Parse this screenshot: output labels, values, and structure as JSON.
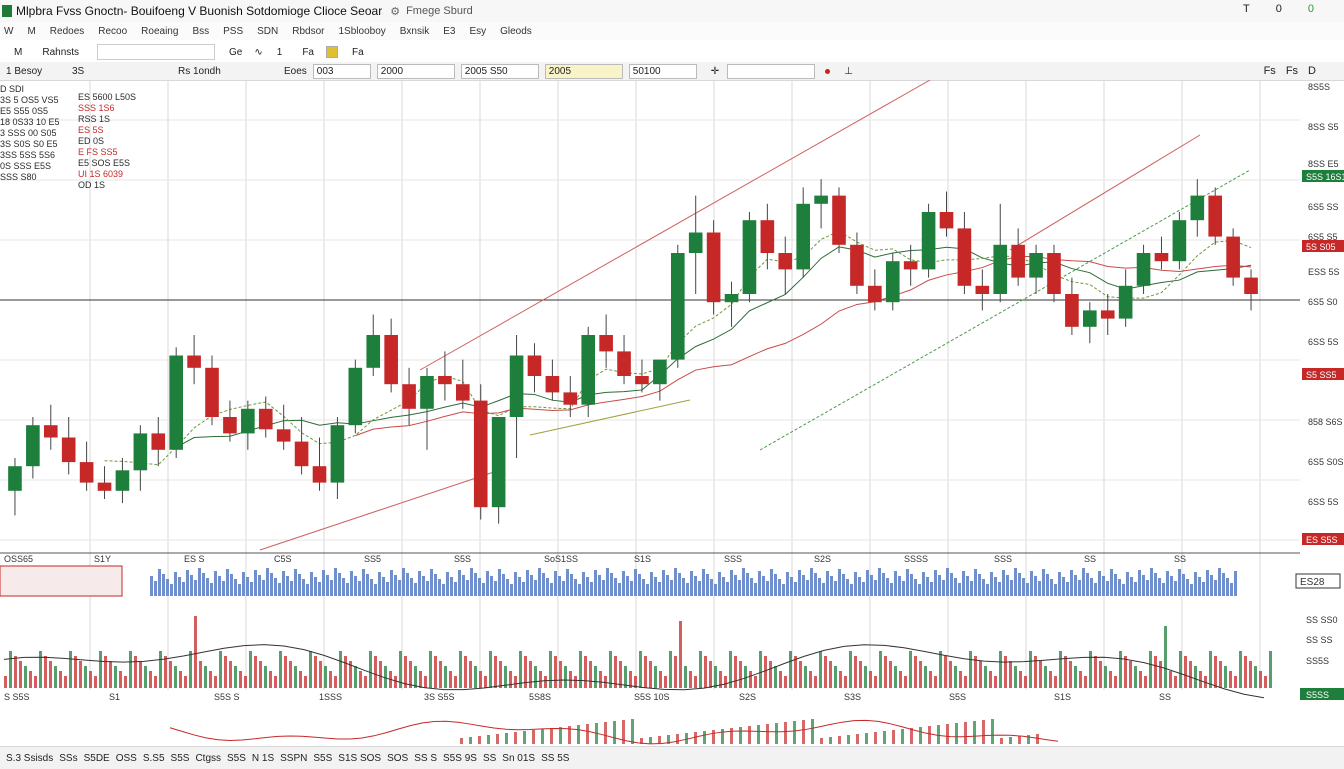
{
  "window": {
    "title": "Mlpbra Fvss Gnoctn- Bouifoeng V Buonish Sotdomioge Clioce Seoar",
    "links": [
      "Fmege Sburd"
    ],
    "controls": [
      "T",
      "0",
      "0"
    ]
  },
  "menu": {
    "items": [
      "W",
      "M",
      "Redoes",
      "Recoo",
      "Roeaing",
      "Bss",
      "PSS",
      "SDN",
      "Rbdsor",
      "1Sblooboy",
      "Bxnsik",
      "E3",
      "Esy",
      "Gleods"
    ]
  },
  "toolbar": {
    "buttons": [
      "M",
      "Rahnsts",
      "Ge",
      "1",
      "Fa",
      "Fa"
    ],
    "search_value": ""
  },
  "toolbar2": {
    "symbol": "1 Besoy",
    "tf": "3S",
    "mode": "Rs 1ondh",
    "type": "Eoes",
    "field1": "003",
    "field2": "2000",
    "field3": "2005 S50",
    "field4": "2005",
    "field5": "50100",
    "right_icons": [
      "Fs",
      "Fs",
      "D"
    ]
  },
  "colors": {
    "bull": "#1e7f3c",
    "bear": "#c62828",
    "grid": "#d9d9d9",
    "vol": "#6f8fcf"
  },
  "info_panel": {
    "left_lines": [
      "D SDI",
      "3S 5 OS5 VS5",
      "E5 S55 0S5",
      "18 0S33 10 E5",
      "3 SSS 00 S05",
      "3S S0S S0 E5",
      "3SS 5SS 5S6",
      "0S SSS E5S",
      "SSS S80"
    ],
    "right_lines": [
      "ES 5600 L50S",
      "SSS 1S6",
      "RSS 1S",
      "ES 5S",
      "ED 0S",
      "E FS SS5",
      "E5 SOS E5S",
      "UI 1S 6039",
      "OD 1S"
    ]
  },
  "price_labels": [
    "8S5S",
    "8SS S5",
    "8SS E5",
    "6S5 SS",
    "6S5 S5",
    "ESS 5S",
    "6S5 S0",
    "6SS 5S",
    "858 S6S",
    "6S5 S0S",
    "6SS 5S"
  ],
  "price_tags": [
    "S5S 16S1",
    "5S S05",
    "S5 SS5",
    "ES S5S"
  ],
  "axis_labels_main": [
    "OSS65",
    "S1Y",
    "ES S",
    "C5S",
    "SS5",
    "S5S",
    "SoS1SS",
    "S1S",
    "SSS",
    "S2S",
    "SSSS",
    "SSS",
    "SS",
    "SS"
  ],
  "volume_label": "ES28",
  "osc_labels": [
    "SS SS0",
    "SS SS",
    "SS5S"
  ],
  "osc_tag": "S5SS",
  "osc_axis_labels": [
    "S S5S",
    "S1",
    "S5S S",
    "1SSS",
    "3S S5S",
    "5S8S",
    "S5S 10S",
    "S2S",
    "S3S",
    "S5S",
    "S1S",
    "SS"
  ],
  "status": [
    "S.3 Ssisds",
    "SSs",
    "S5DE",
    "OSS",
    "S.S5",
    "S5S",
    "Ctgss",
    "S5S",
    "N 1S",
    "SSPN",
    "S5S",
    "S1S SOS",
    "SOS",
    "SS S",
    "S5S 9S",
    "SS",
    "Sn 01S",
    "SS 5S"
  ],
  "chart_data": {
    "type": "candlestick",
    "main_ylim": [
      0,
      100
    ],
    "candles": [
      {
        "o": 12,
        "h": 20,
        "l": 6,
        "c": 18
      },
      {
        "o": 18,
        "h": 30,
        "l": 15,
        "c": 28
      },
      {
        "o": 28,
        "h": 33,
        "l": 22,
        "c": 25
      },
      {
        "o": 25,
        "h": 30,
        "l": 16,
        "c": 19
      },
      {
        "o": 19,
        "h": 24,
        "l": 12,
        "c": 14
      },
      {
        "o": 14,
        "h": 18,
        "l": 10,
        "c": 12
      },
      {
        "o": 12,
        "h": 20,
        "l": 9,
        "c": 17
      },
      {
        "o": 17,
        "h": 28,
        "l": 12,
        "c": 26
      },
      {
        "o": 26,
        "h": 30,
        "l": 18,
        "c": 22
      },
      {
        "o": 22,
        "h": 47,
        "l": 20,
        "c": 45
      },
      {
        "o": 45,
        "h": 50,
        "l": 38,
        "c": 42
      },
      {
        "o": 42,
        "h": 45,
        "l": 28,
        "c": 30
      },
      {
        "o": 30,
        "h": 34,
        "l": 24,
        "c": 26
      },
      {
        "o": 26,
        "h": 34,
        "l": 22,
        "c": 32
      },
      {
        "o": 32,
        "h": 35,
        "l": 25,
        "c": 27
      },
      {
        "o": 27,
        "h": 33,
        "l": 22,
        "c": 24
      },
      {
        "o": 24,
        "h": 30,
        "l": 16,
        "c": 18
      },
      {
        "o": 18,
        "h": 25,
        "l": 12,
        "c": 14
      },
      {
        "o": 14,
        "h": 30,
        "l": 10,
        "c": 28
      },
      {
        "o": 28,
        "h": 44,
        "l": 26,
        "c": 42
      },
      {
        "o": 42,
        "h": 55,
        "l": 40,
        "c": 50
      },
      {
        "o": 50,
        "h": 54,
        "l": 36,
        "c": 38
      },
      {
        "o": 38,
        "h": 42,
        "l": 28,
        "c": 32
      },
      {
        "o": 32,
        "h": 42,
        "l": 22,
        "c": 40
      },
      {
        "o": 40,
        "h": 46,
        "l": 34,
        "c": 38
      },
      {
        "o": 38,
        "h": 44,
        "l": 32,
        "c": 34
      },
      {
        "o": 34,
        "h": 38,
        "l": 5,
        "c": 8
      },
      {
        "o": 8,
        "h": 14,
        "l": 4,
        "c": 30
      },
      {
        "o": 30,
        "h": 50,
        "l": 20,
        "c": 45
      },
      {
        "o": 45,
        "h": 48,
        "l": 36,
        "c": 40
      },
      {
        "o": 40,
        "h": 44,
        "l": 34,
        "c": 36
      },
      {
        "o": 36,
        "h": 40,
        "l": 30,
        "c": 33
      },
      {
        "o": 33,
        "h": 52,
        "l": 30,
        "c": 50
      },
      {
        "o": 50,
        "h": 55,
        "l": 42,
        "c": 46
      },
      {
        "o": 46,
        "h": 50,
        "l": 38,
        "c": 40
      },
      {
        "o": 40,
        "h": 44,
        "l": 36,
        "c": 38
      },
      {
        "o": 38,
        "h": 42,
        "l": 34,
        "c": 44
      },
      {
        "o": 44,
        "h": 72,
        "l": 42,
        "c": 70
      },
      {
        "o": 70,
        "h": 84,
        "l": 60,
        "c": 75
      },
      {
        "o": 75,
        "h": 78,
        "l": 55,
        "c": 58
      },
      {
        "o": 58,
        "h": 63,
        "l": 52,
        "c": 60
      },
      {
        "o": 60,
        "h": 80,
        "l": 58,
        "c": 78
      },
      {
        "o": 78,
        "h": 82,
        "l": 66,
        "c": 70
      },
      {
        "o": 70,
        "h": 74,
        "l": 60,
        "c": 66
      },
      {
        "o": 66,
        "h": 86,
        "l": 64,
        "c": 82
      },
      {
        "o": 82,
        "h": 88,
        "l": 76,
        "c": 84
      },
      {
        "o": 84,
        "h": 86,
        "l": 70,
        "c": 72
      },
      {
        "o": 72,
        "h": 75,
        "l": 60,
        "c": 62
      },
      {
        "o": 62,
        "h": 66,
        "l": 56,
        "c": 58
      },
      {
        "o": 58,
        "h": 70,
        "l": 56,
        "c": 68
      },
      {
        "o": 68,
        "h": 72,
        "l": 62,
        "c": 66
      },
      {
        "o": 66,
        "h": 82,
        "l": 64,
        "c": 80
      },
      {
        "o": 80,
        "h": 85,
        "l": 74,
        "c": 76
      },
      {
        "o": 76,
        "h": 80,
        "l": 60,
        "c": 62
      },
      {
        "o": 62,
        "h": 66,
        "l": 56,
        "c": 60
      },
      {
        "o": 60,
        "h": 82,
        "l": 58,
        "c": 72
      },
      {
        "o": 72,
        "h": 76,
        "l": 62,
        "c": 64
      },
      {
        "o": 64,
        "h": 72,
        "l": 60,
        "c": 70
      },
      {
        "o": 70,
        "h": 72,
        "l": 58,
        "c": 60
      },
      {
        "o": 60,
        "h": 64,
        "l": 50,
        "c": 52
      },
      {
        "o": 52,
        "h": 58,
        "l": 48,
        "c": 56
      },
      {
        "o": 56,
        "h": 60,
        "l": 50,
        "c": 54
      },
      {
        "o": 54,
        "h": 66,
        "l": 52,
        "c": 62
      },
      {
        "o": 62,
        "h": 72,
        "l": 60,
        "c": 70
      },
      {
        "o": 70,
        "h": 74,
        "l": 66,
        "c": 68
      },
      {
        "o": 68,
        "h": 80,
        "l": 66,
        "c": 78
      },
      {
        "o": 78,
        "h": 88,
        "l": 74,
        "c": 84
      },
      {
        "o": 84,
        "h": 86,
        "l": 72,
        "c": 74
      },
      {
        "o": 74,
        "h": 76,
        "l": 62,
        "c": 64
      },
      {
        "o": 64,
        "h": 66,
        "l": 56,
        "c": 60
      }
    ]
  }
}
